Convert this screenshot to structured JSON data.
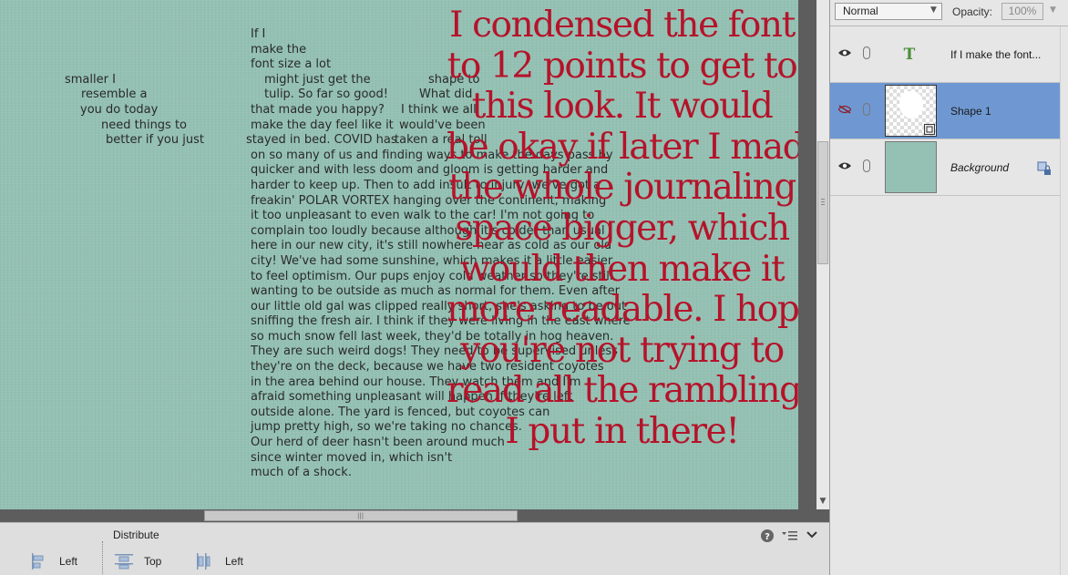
{
  "journal_text": [
    [
      "If I"
    ],
    [
      "make the"
    ],
    [
      "font size a lot"
    ],
    [
      "smaller I",
      "might just get the",
      "shape to"
    ],
    [
      "resemble a",
      "tulip. So far so good!",
      "What did"
    ],
    [
      "you do today",
      "that made you happy?",
      "I think we all"
    ],
    [
      "need things to",
      "make the day feel like it",
      "would've been"
    ],
    [
      "better if you just",
      "stayed in bed. COVID has",
      "taken a real toll"
    ],
    [
      "on so many of us and finding ways to make the days pass by"
    ],
    [
      "quicker and with less doom and gloom is getting harder and"
    ],
    [
      "harder to keep up. Then to add insult to injury, we've got a"
    ],
    [
      "freakin' POLAR VORTEX hanging over the continent, making"
    ],
    [
      "it too unpleasant to even walk to the car! I'm not going to"
    ],
    [
      "complain too loudly because although it's colder than usual"
    ],
    [
      "here in our new city, it's still nowhere near as cold as our old"
    ],
    [
      "city! We've had some sunshine, which makes it a little easier"
    ],
    [
      "to feel optimism. Our pups enjoy cold weather so they're still"
    ],
    [
      "wanting to be outside as much as normal for them. Even after"
    ],
    [
      "our little old gal was clipped really short, she's asking to be out"
    ],
    [
      "sniffing the fresh air. I think if they were living in the east where"
    ],
    [
      "so much snow fell last week, they'd be totally in hog heaven."
    ],
    [
      "They are such weird dogs! They need to be supervised unless"
    ],
    [
      "they're on the deck, because we have two resident coyotes"
    ],
    [
      "in the area behind our house. They watch them and I'm"
    ],
    [
      "afraid something unpleasant will happen if they're left"
    ],
    [
      "outside alone. The yard is fenced, but coyotes can"
    ],
    [
      "jump pretty high, so we're taking no chances."
    ],
    [
      "Our herd of deer hasn't been around much"
    ],
    [
      "since winter moved in, which isn't"
    ],
    [
      "much of a shock."
    ]
  ],
  "caption_lines": [
    "I condensed the font",
    "to 12 points to get to",
    "this look. It would",
    "be okay if later I made",
    "the whole journaling",
    "space bigger, which",
    "would then make it",
    "more readable. I hope",
    "you're not trying to",
    "read all the rambling",
    "I put in there!"
  ],
  "colors": {
    "canvas_bg": "#94c1b3",
    "caption": "#b5132a",
    "selection": "#6f98d2"
  },
  "layers_panel": {
    "blend_mode": "Normal",
    "opacity_label": "Opacity:",
    "opacity_value": "100%",
    "layers": [
      {
        "name": "If I make the font...",
        "type": "text",
        "visible": true,
        "selected": false,
        "thumb_glyph": "T"
      },
      {
        "name": "Shape 1",
        "type": "shape",
        "visible": false,
        "selected": true
      },
      {
        "name": "Background",
        "type": "background",
        "visible": true,
        "selected": false,
        "locked": true
      }
    ]
  },
  "tool_options": {
    "distribute_label": "Distribute",
    "align_left_label": "Left",
    "distribute_top_label": "Top",
    "distribute_left_label": "Left",
    "help_icon": "help-icon",
    "menu_icon": "panel-menu-icon",
    "collapse_icon": "chevron-down-icon"
  },
  "scrollbar_grip": "⦙"
}
